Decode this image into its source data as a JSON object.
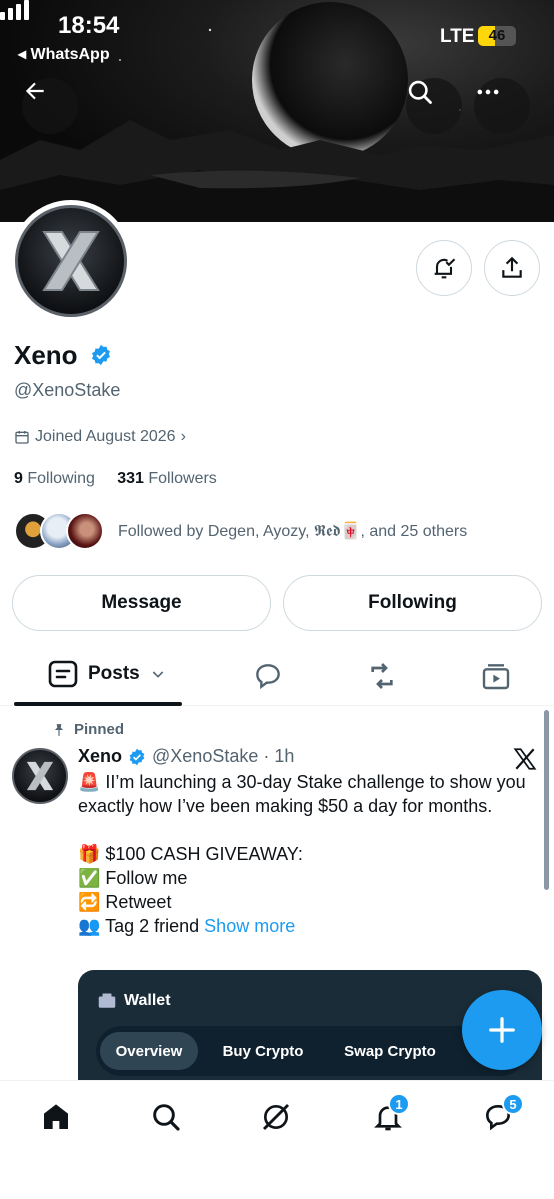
{
  "status_bar": {
    "time": "18:54",
    "back_app": "WhatsApp",
    "network": "LTE",
    "battery": "46",
    "battery_level": 0.46
  },
  "profile": {
    "name": "Xeno",
    "handle": "@XenoStake",
    "joined": "Joined August 2026",
    "following_count": "9",
    "following_label": "Following",
    "followers_count": "331",
    "followers_label": "Followers",
    "followed_by": "Followed by Degen, Ayozy, 𝕽𝖊𝖉🀄, and 25 others"
  },
  "actions": {
    "message_label": "Message",
    "following_label": "Following"
  },
  "tabs": {
    "posts_label": "Posts"
  },
  "post": {
    "pinned_label": "Pinned",
    "author": "Xeno",
    "handle_time": "@XenoStake · 1h",
    "lines": [
      "🚨 II’m launching a 30-day Stake challenge to show you exactly how I’ve been making $50 a day for months.",
      "",
      "🎁 $100 CASH GIVEAWAY:",
      "✅ Follow me",
      "🔁 Retweet",
      "👥 Tag 2 friend"
    ],
    "show_more": "Show more",
    "wallet": {
      "title": "Wallet",
      "tabs": [
        "Overview",
        "Buy Crypto",
        "Swap Crypto"
      ]
    }
  },
  "nav": {
    "notifications_badge": "1",
    "messages_badge": "5"
  },
  "colors": {
    "accent": "#1d9bf0",
    "text": "#0f1419",
    "muted": "#536471"
  }
}
